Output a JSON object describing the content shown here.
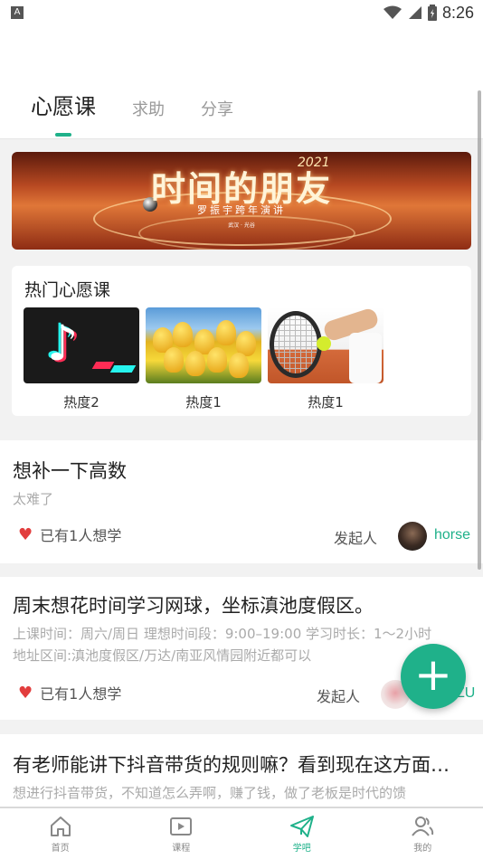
{
  "status_bar": {
    "time": "8:26",
    "left_icon_letter": "A"
  },
  "tabs": [
    {
      "label": "心愿课",
      "active": true
    },
    {
      "label": "求助",
      "active": false
    },
    {
      "label": "分享",
      "active": false
    }
  ],
  "banner": {
    "title": "时间的朋友",
    "year": "2021",
    "subtitle": "罗振宇跨年演讲",
    "tiny_text": "武汉 · 光谷"
  },
  "hot_section": {
    "heading": "热门心愿课",
    "items": [
      {
        "caption": "热度2",
        "image": "tiktok-logo"
      },
      {
        "caption": "热度1",
        "image": "yellow-tulips"
      },
      {
        "caption": "热度1",
        "image": "tennis-player"
      }
    ]
  },
  "posts": [
    {
      "title": "想补一下高数",
      "desc_lines": [
        "太难了"
      ],
      "want_text": "已有1人想学",
      "initiator_label": "发起人",
      "username": "horse"
    },
    {
      "title": "周末想花时间学习网球，坐标滇池度假区。",
      "desc_lines": [
        "上课时间：周六/周日 理想时间段：9:00–19:00 学习时长：1～2小时",
        "地址区间:滇池度假区/万达/南亚风情园附近都可以"
      ],
      "want_text": "已有1人想学",
      "initiator_label": "发起人",
      "username": "ZU"
    },
    {
      "title": "有老师能讲下抖音带货的规则嘛？看到现在这方面…",
      "desc_lines": [
        "想进行抖音带货，不知道怎么弄啊，赚了钱，做了老板是时代的馈"
      ]
    }
  ],
  "fab": {
    "label": "+"
  },
  "bottom_nav": [
    {
      "label": "首页",
      "icon": "home-icon",
      "active": false
    },
    {
      "label": "课程",
      "icon": "play-icon",
      "active": false
    },
    {
      "label": "学吧",
      "icon": "paper-plane-icon",
      "active": true
    },
    {
      "label": "我的",
      "icon": "user-icon",
      "active": false
    }
  ],
  "colors": {
    "accent": "#1fb18a",
    "heart": "#e23d3d"
  }
}
